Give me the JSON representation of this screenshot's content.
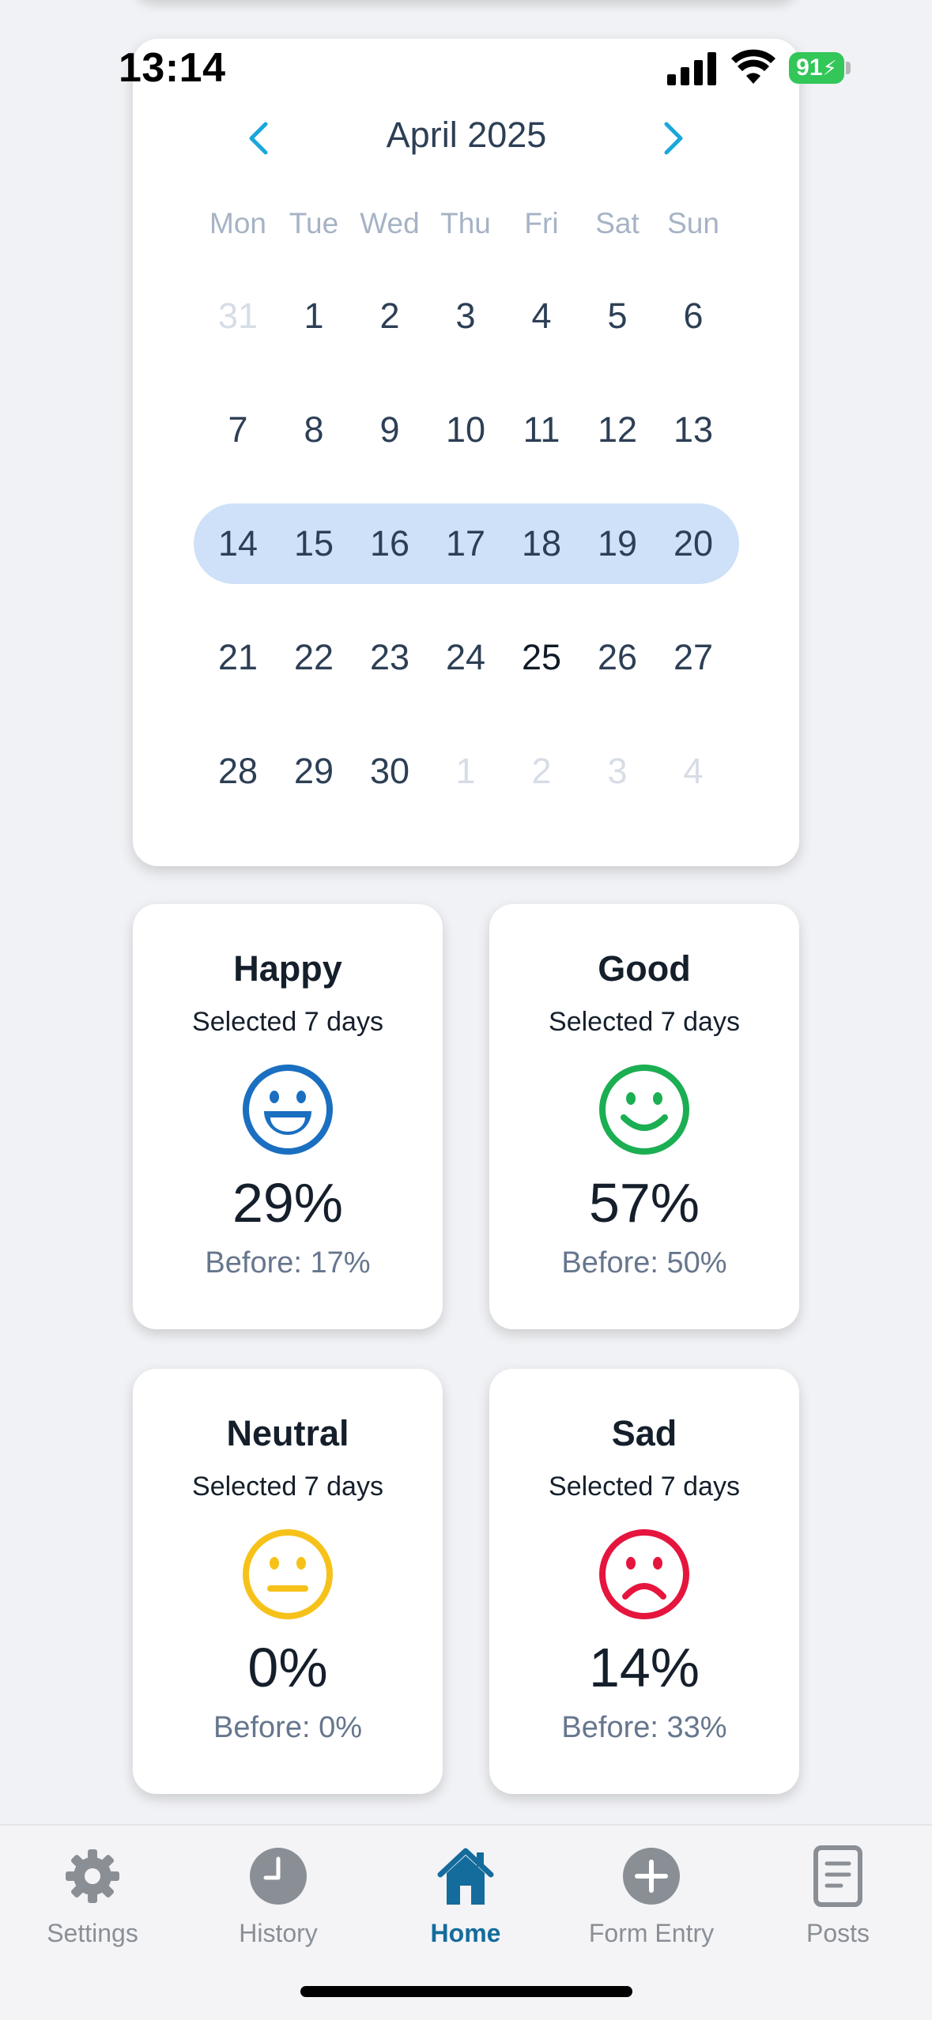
{
  "status_bar": {
    "time": "13:14",
    "battery": "91"
  },
  "calendar": {
    "title": "April 2025",
    "weekdays": [
      "Mon",
      "Tue",
      "Wed",
      "Thu",
      "Fri",
      "Sat",
      "Sun"
    ],
    "weeks": [
      [
        "31",
        "1",
        "2",
        "3",
        "4",
        "5",
        "6"
      ],
      [
        "7",
        "8",
        "9",
        "10",
        "11",
        "12",
        "13"
      ],
      [
        "14",
        "15",
        "16",
        "17",
        "18",
        "19",
        "20"
      ],
      [
        "21",
        "22",
        "23",
        "24",
        "25",
        "26",
        "27"
      ],
      [
        "28",
        "29",
        "30",
        "1",
        "2",
        "3",
        "4"
      ]
    ],
    "selected_week_index": 2,
    "today": "25",
    "highlight_color": "#cfe1f8",
    "nav_color": "#19a7dc"
  },
  "moods": [
    {
      "title": "Happy",
      "subtitle": "Selected 7 days",
      "percent": "29%",
      "before": "Before: 17%",
      "icon": "happy-face-icon",
      "color": "#1a6fc0"
    },
    {
      "title": "Good",
      "subtitle": "Selected 7 days",
      "percent": "57%",
      "before": "Before: 50%",
      "icon": "smile-face-icon",
      "color": "#1cae52"
    },
    {
      "title": "Neutral",
      "subtitle": "Selected 7 days",
      "percent": "0%",
      "before": "Before: 0%",
      "icon": "neutral-face-icon",
      "color": "#f6c21a"
    },
    {
      "title": "Sad",
      "subtitle": "Selected 7 days",
      "percent": "14%",
      "before": "Before: 33%",
      "icon": "sad-face-icon",
      "color": "#e5153d"
    }
  ],
  "tabs": [
    {
      "label": "Settings",
      "icon": "gear-icon",
      "active": false
    },
    {
      "label": "History",
      "icon": "clock-icon",
      "active": false
    },
    {
      "label": "Home",
      "icon": "home-icon",
      "active": true
    },
    {
      "label": "Form Entry",
      "icon": "plus-circle-icon",
      "active": false
    },
    {
      "label": "Posts",
      "icon": "document-icon",
      "active": false
    }
  ],
  "colors": {
    "tab_active": "#146c9c",
    "tab_inactive": "#8a8f96"
  }
}
